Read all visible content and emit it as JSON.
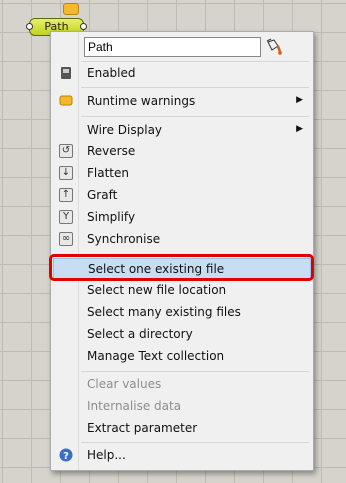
{
  "canvas": {
    "grid_color": "#bfbab3"
  },
  "component": {
    "name": "Path"
  },
  "menu": {
    "name_field": {
      "value": "Path"
    },
    "items": [
      {
        "label": "Enabled",
        "icon": "enabled-icon"
      },
      {
        "label": "Runtime warnings",
        "icon": "warning-icon",
        "submenu": true
      },
      {
        "label": "Wire Display",
        "submenu": true
      },
      {
        "label": "Reverse",
        "icon": "reverse-icon"
      },
      {
        "label": "Flatten",
        "icon": "flatten-icon"
      },
      {
        "label": "Graft",
        "icon": "graft-icon"
      },
      {
        "label": "Simplify",
        "icon": "simplify-icon"
      },
      {
        "label": "Synchronise",
        "icon": "synchronise-icon"
      },
      {
        "label": "Select one existing file",
        "highlighted": true
      },
      {
        "label": "Select new file location"
      },
      {
        "label": "Select many existing files"
      },
      {
        "label": "Select a directory"
      },
      {
        "label": "Manage Text collection"
      },
      {
        "label": "Clear values",
        "disabled": true
      },
      {
        "label": "Internalise data",
        "disabled": true
      },
      {
        "label": "Extract parameter"
      },
      {
        "label": "Help...",
        "icon": "help-icon"
      }
    ]
  },
  "highlight_color": "#e00000"
}
